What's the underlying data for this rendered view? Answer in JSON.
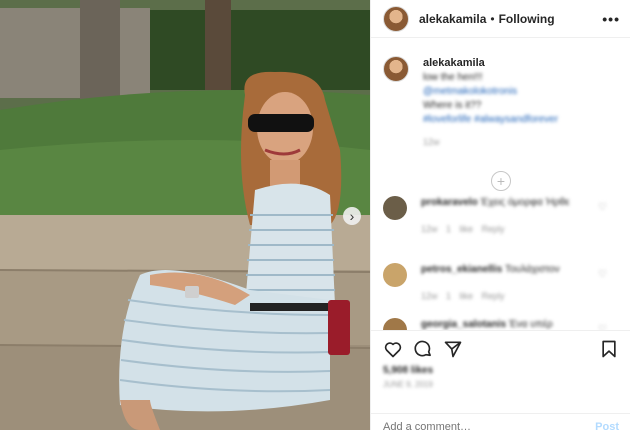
{
  "header": {
    "username": "alekakamila",
    "separator": "•",
    "follow_status": "Following",
    "more_label": "•••"
  },
  "caption": {
    "username": "alekakamila",
    "line1": "low the hen!!!",
    "mention": "@metmakolokotronis",
    "line3": "Where is it??",
    "hashtags": "#loveforlife #alwaysandforever",
    "time": "12w"
  },
  "load_more": "+",
  "comments": [
    {
      "username": "prokaravelo",
      "text": "Έχεις όμορφα Ήρθε",
      "meta": "12w 1 like Reply",
      "avatar_color": "#6b5e48"
    },
    {
      "username": "petros_ekianellis",
      "text": "Τουλάχιστον",
      "meta": "12w 1 like Reply",
      "avatar_color": "#c9a46a"
    },
    {
      "username": "georgia_salotanis",
      "text": "Ένα υπέρ",
      "meta": "",
      "avatar_color": "#a07848"
    }
  ],
  "likes": "5,908 likes",
  "date": "JUNE 9, 2019",
  "add_comment": {
    "placeholder": "Add a comment…",
    "post_label": "Post"
  },
  "next_label": "›"
}
